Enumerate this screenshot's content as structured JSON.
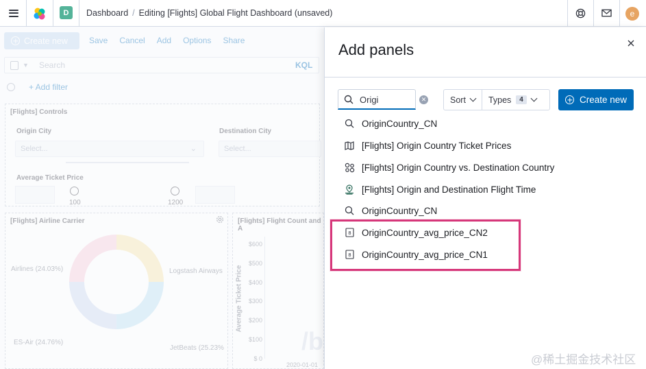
{
  "header": {
    "space_initial": "D",
    "user_initial": "e",
    "breadcrumbs": {
      "root": "Dashboard",
      "current": "Editing [Flights] Global Flight Dashboard (unsaved)"
    },
    "icons": [
      "menu-icon",
      "elastic-logo-icon",
      "help-icon",
      "mail-icon"
    ]
  },
  "dashboard": {
    "create_new_label": "Create new",
    "menu": [
      "Save",
      "Cancel",
      "Add",
      "Options",
      "Share"
    ],
    "search_placeholder": "Search",
    "kql_label": "KQL",
    "add_filter_label": "+ Add filter",
    "controls_panel": {
      "title": "[Flights] Controls",
      "origin_city_label": "Origin City",
      "origin_city_placeholder": "Select...",
      "destination_city_label": "Destination City",
      "destination_city_placeholder": "Select...",
      "avg_ticket_label": "Average Ticket Price",
      "range_min": "100",
      "range_max": "1200"
    },
    "airline_panel": {
      "title": "[Flights] Airline Carrier",
      "labels": [
        "Airlines (24.03%)",
        "Logstash Airways",
        "ES-Air (24.76%)",
        "JetBeats (25.23%"
      ]
    },
    "flight_count_panel": {
      "title": "[Flights] Flight Count and A",
      "y_ticks": [
        "$600",
        "$500",
        "$400",
        "$300",
        "$200",
        "$100",
        "$ 0"
      ],
      "y_axis_title": "Average Ticket Price",
      "x_tick": "2020-01-01"
    }
  },
  "flyout": {
    "title": "Add panels",
    "search_value": "Origi",
    "sort_label": "Sort",
    "types_label": "Types",
    "types_count": "4",
    "create_new_label": "Create new",
    "results": [
      {
        "label": "OriginCountry_CN",
        "icon": "search-icon"
      },
      {
        "label": "[Flights] Origin Country Ticket Prices",
        "icon": "map-icon"
      },
      {
        "label": "[Flights] Origin Country vs. Destination Country",
        "icon": "vega-icon"
      },
      {
        "label": "[Flights] Origin and Destination Flight Time",
        "icon": "region-map-icon"
      },
      {
        "label": "OriginCountry_CN",
        "icon": "search-icon"
      },
      {
        "label": "OriginCountry_avg_price_CN2",
        "icon": "metric-icon"
      },
      {
        "label": "OriginCountry_avg_price_CN1",
        "icon": "metric-icon"
      }
    ]
  },
  "watermark": "@稀土掘金技术社区"
}
